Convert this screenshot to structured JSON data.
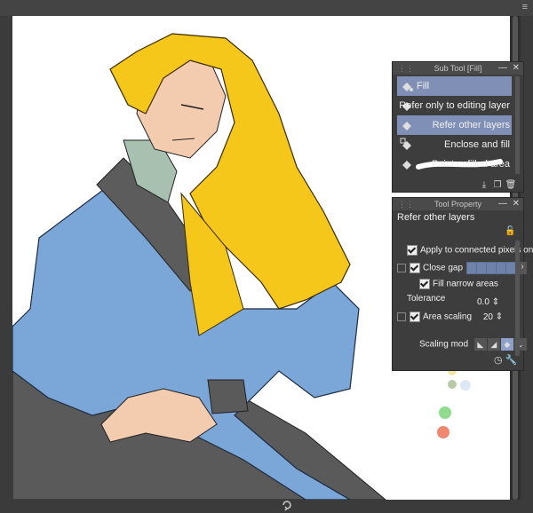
{
  "window": {
    "menu_icon": "hamburger-icon"
  },
  "sub_tool_panel": {
    "title": "Sub Tool [Fill]",
    "items": [
      {
        "label": "Fill",
        "icon": "fill-bucket-icon",
        "selected": true
      },
      {
        "label": "Refer only to editing layer",
        "icon": "fill-bucket-icon",
        "selected": false
      },
      {
        "label": "Refer other layers",
        "icon": "fill-bucket-icon",
        "selected": true
      },
      {
        "label": "Enclose and fill",
        "icon": "enclose-fill-icon",
        "selected": false
      },
      {
        "label": "Paint unfilled area",
        "icon": "paint-unfilled-icon",
        "selected": false
      }
    ]
  },
  "tool_property_panel": {
    "title": "Tool Property",
    "subtool_name": "Refer other layers",
    "apply_connected": "Apply to connected pixels only",
    "close_gap": "Close gap",
    "fill_narrow": "Fill narrow areas",
    "tolerance_label": "Tolerance",
    "tolerance_value": "0.0",
    "area_scaling_label": "Area scaling",
    "area_scaling_value": "20",
    "scaling_mode_label": "Scaling mod"
  },
  "palette_colors": [
    "#f5e6a8",
    "#b8c9a8",
    "#dde8f5",
    "#8fdc8f",
    "#f08870"
  ]
}
